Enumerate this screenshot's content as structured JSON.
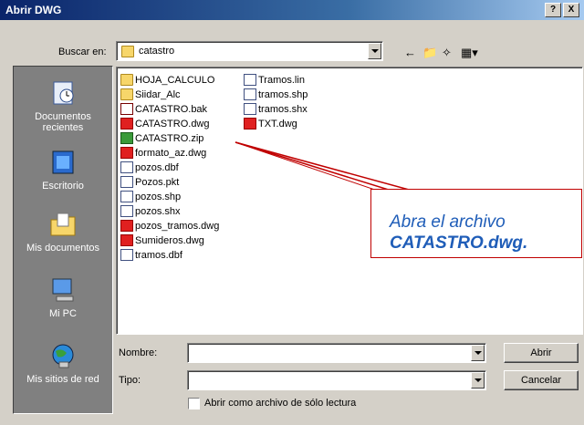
{
  "window": {
    "title": "Abrir DWG",
    "help_btn": "?",
    "close_btn": "X"
  },
  "lookin": {
    "label": "Buscar en:",
    "value": "catastro"
  },
  "places": [
    {
      "name": "documentos-recientes",
      "line1": "Documentos",
      "line2": "recientes",
      "icon": "recent-docs-icon"
    },
    {
      "name": "escritorio",
      "line1": "Escritorio",
      "line2": "",
      "icon": "desktop-icon"
    },
    {
      "name": "mis-documentos",
      "line1": "Mis documentos",
      "line2": "",
      "icon": "my-documents-icon"
    },
    {
      "name": "mi-pc",
      "line1": "Mi PC",
      "line2": "",
      "icon": "my-computer-icon"
    },
    {
      "name": "mis-sitios-de-red",
      "line1": "Mis sitios de red",
      "line2": "",
      "icon": "network-icon"
    }
  ],
  "files_col1": [
    {
      "name": "HOJA_CALCULO",
      "type": "folder"
    },
    {
      "name": "Siidar_Alc",
      "type": "folder"
    },
    {
      "name": "CATASTRO.bak",
      "type": "bak"
    },
    {
      "name": "CATASTRO.dwg",
      "type": "dwg"
    },
    {
      "name": "CATASTRO.zip",
      "type": "zip"
    },
    {
      "name": "formato_az.dwg",
      "type": "dwg"
    },
    {
      "name": "pozos.dbf",
      "type": "doc"
    },
    {
      "name": "Pozos.pkt",
      "type": "doc"
    },
    {
      "name": "pozos.shp",
      "type": "doc"
    },
    {
      "name": "pozos.shx",
      "type": "doc"
    },
    {
      "name": "pozos_tramos.dwg",
      "type": "dwg"
    },
    {
      "name": "Sumideros.dwg",
      "type": "dwg"
    },
    {
      "name": "tramos.dbf",
      "type": "doc"
    }
  ],
  "files_col2": [
    {
      "name": "Tramos.lin",
      "type": "doc"
    },
    {
      "name": "tramos.shp",
      "type": "doc"
    },
    {
      "name": "tramos.shx",
      "type": "doc"
    },
    {
      "name": "TXT.dwg",
      "type": "dwg"
    }
  ],
  "filename": {
    "label": "Nombre:",
    "value": ""
  },
  "filetype": {
    "label": "Tipo:",
    "value": ""
  },
  "buttons": {
    "open": "Abrir",
    "cancel": "Cancelar"
  },
  "readonly": {
    "label": "Abrir como archivo de sólo lectura"
  },
  "callout": {
    "line1": "Abra el archivo",
    "line2": "CATASTRO.dwg."
  }
}
